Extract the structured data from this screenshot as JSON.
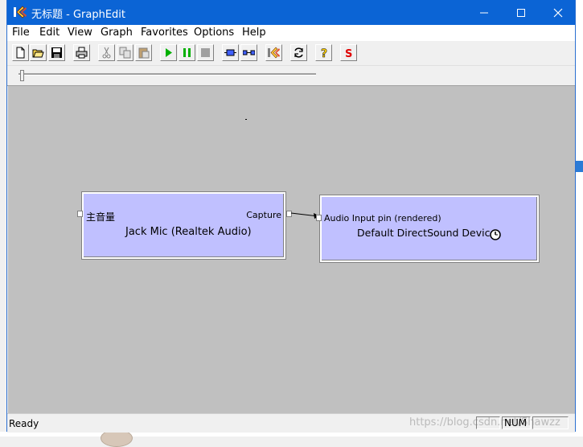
{
  "window": {
    "title": "无标题 - GraphEdit",
    "controls": [
      "minimize",
      "maximize",
      "close"
    ]
  },
  "menu": [
    "File",
    "Edit",
    "View",
    "Graph",
    "Favorites",
    "Options",
    "Help"
  ],
  "toolbar": {
    "buttons": [
      "new",
      "open",
      "save",
      "print",
      "cut",
      "copy",
      "paste",
      "play",
      "pause",
      "stop",
      "seek-filter",
      "renderer",
      "graph-icon",
      "refresh",
      "help",
      "s"
    ],
    "s_label": "S",
    "help_label": "?"
  },
  "graph": {
    "filter1": {
      "input_pin": "主音量",
      "output_pin": "Capture",
      "name": "Jack Mic (Realtek Audio)"
    },
    "filter2": {
      "input_pin": "Audio Input pin (rendered)",
      "name": "Default DirectSound Device"
    }
  },
  "status": {
    "text": "Ready",
    "num": "NUM",
    "watermark": "https://blog.csdn.net/Shawzz"
  }
}
